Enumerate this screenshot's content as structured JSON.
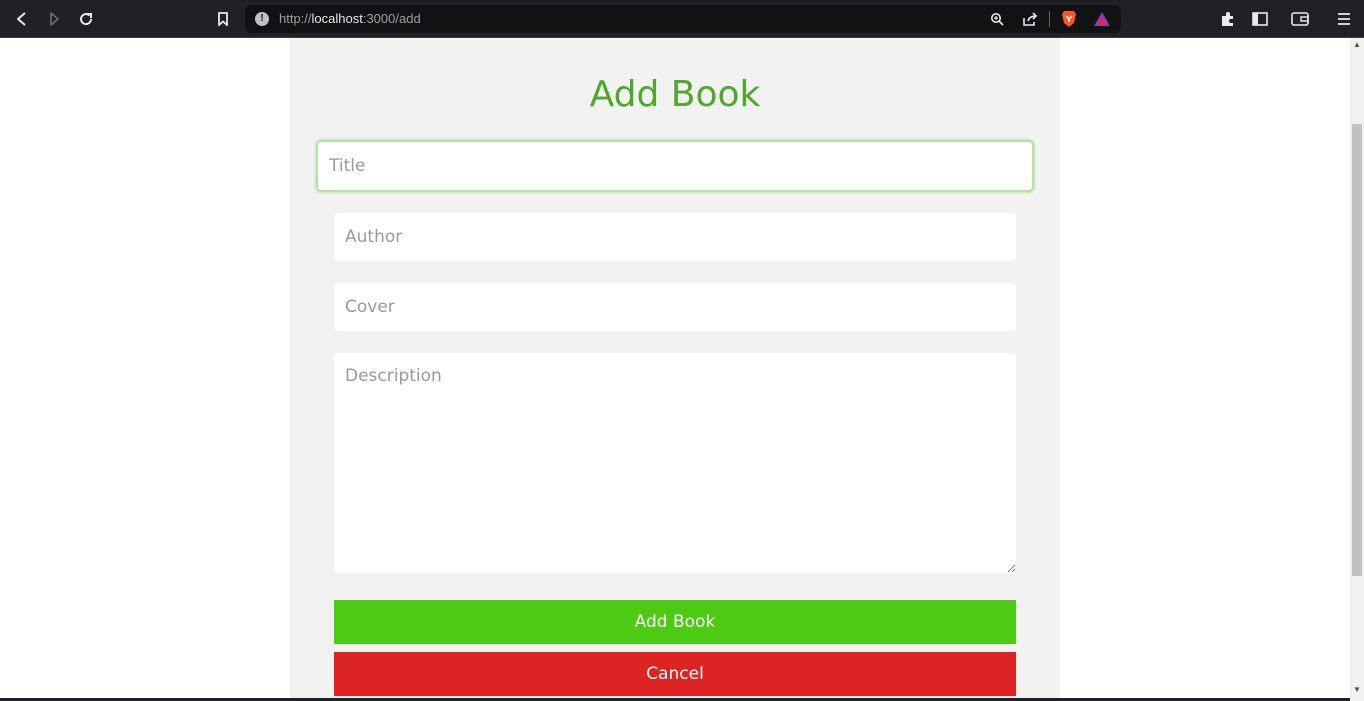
{
  "browser": {
    "url_scheme": "http://",
    "url_host": "localhost",
    "url_path": ":3000/add",
    "info_icon": "info-icon",
    "colors": {
      "toolbar": "#202124",
      "urlbar": "#111214"
    }
  },
  "form": {
    "heading": "Add Book",
    "title_placeholder": "Title",
    "author_placeholder": "Author",
    "cover_placeholder": "Cover",
    "description_placeholder": "Description",
    "add_label": "Add Book",
    "cancel_label": "Cancel",
    "colors": {
      "heading": "#4ea82a",
      "add_button": "#4cca14",
      "cancel_button": "#de2323",
      "panel": "#f2f2f2"
    }
  }
}
